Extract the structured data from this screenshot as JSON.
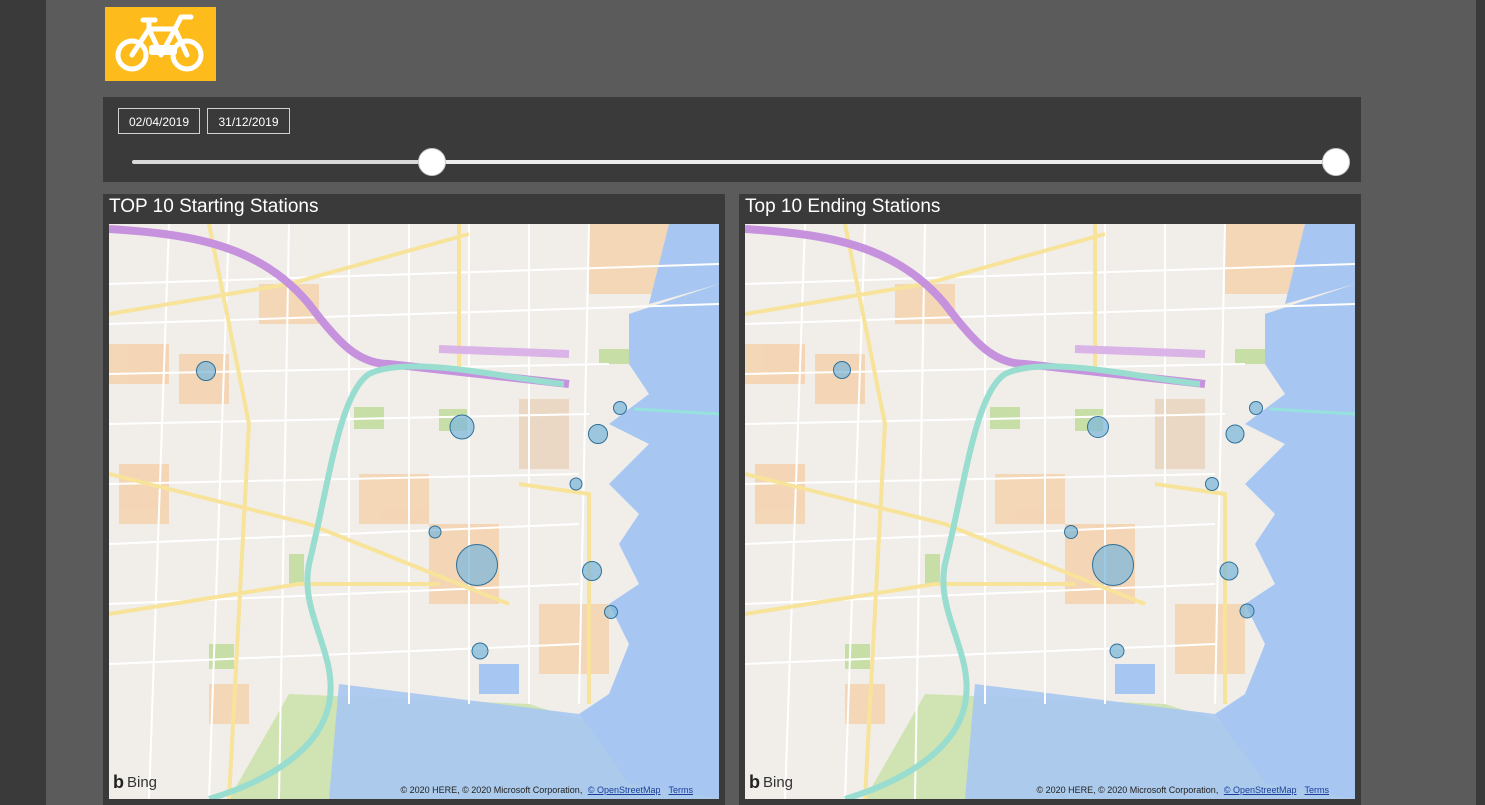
{
  "logo": {
    "icon": "bicycle-icon",
    "background": "#febb1c"
  },
  "date_slicer": {
    "start_date": "02/04/2019",
    "end_date": "31/12/2019",
    "range_start_fraction": 0.25,
    "range_end_fraction": 1.0
  },
  "panels": [
    {
      "title": "TOP 10 Starting Stations",
      "map_brand": "Bing",
      "attribution": "© 2020 HERE, © 2020 Microsoft Corporation, ",
      "osm_link": "© OpenStreetMap",
      "terms_link": "Terms"
    },
    {
      "title": "Top 10 Ending Stations",
      "map_brand": "Bing",
      "attribution": "© 2020 HERE, © 2020 Microsoft Corporation, ",
      "osm_link": "© OpenStreetMap",
      "terms_link": "Terms"
    }
  ],
  "colors": {
    "bubble_fill": "#7fb8d9",
    "bubble_stroke": "#2f6f99",
    "water": "#a6c5f0",
    "park": "#c8dfa8",
    "urban": "#f6d3b0"
  }
}
